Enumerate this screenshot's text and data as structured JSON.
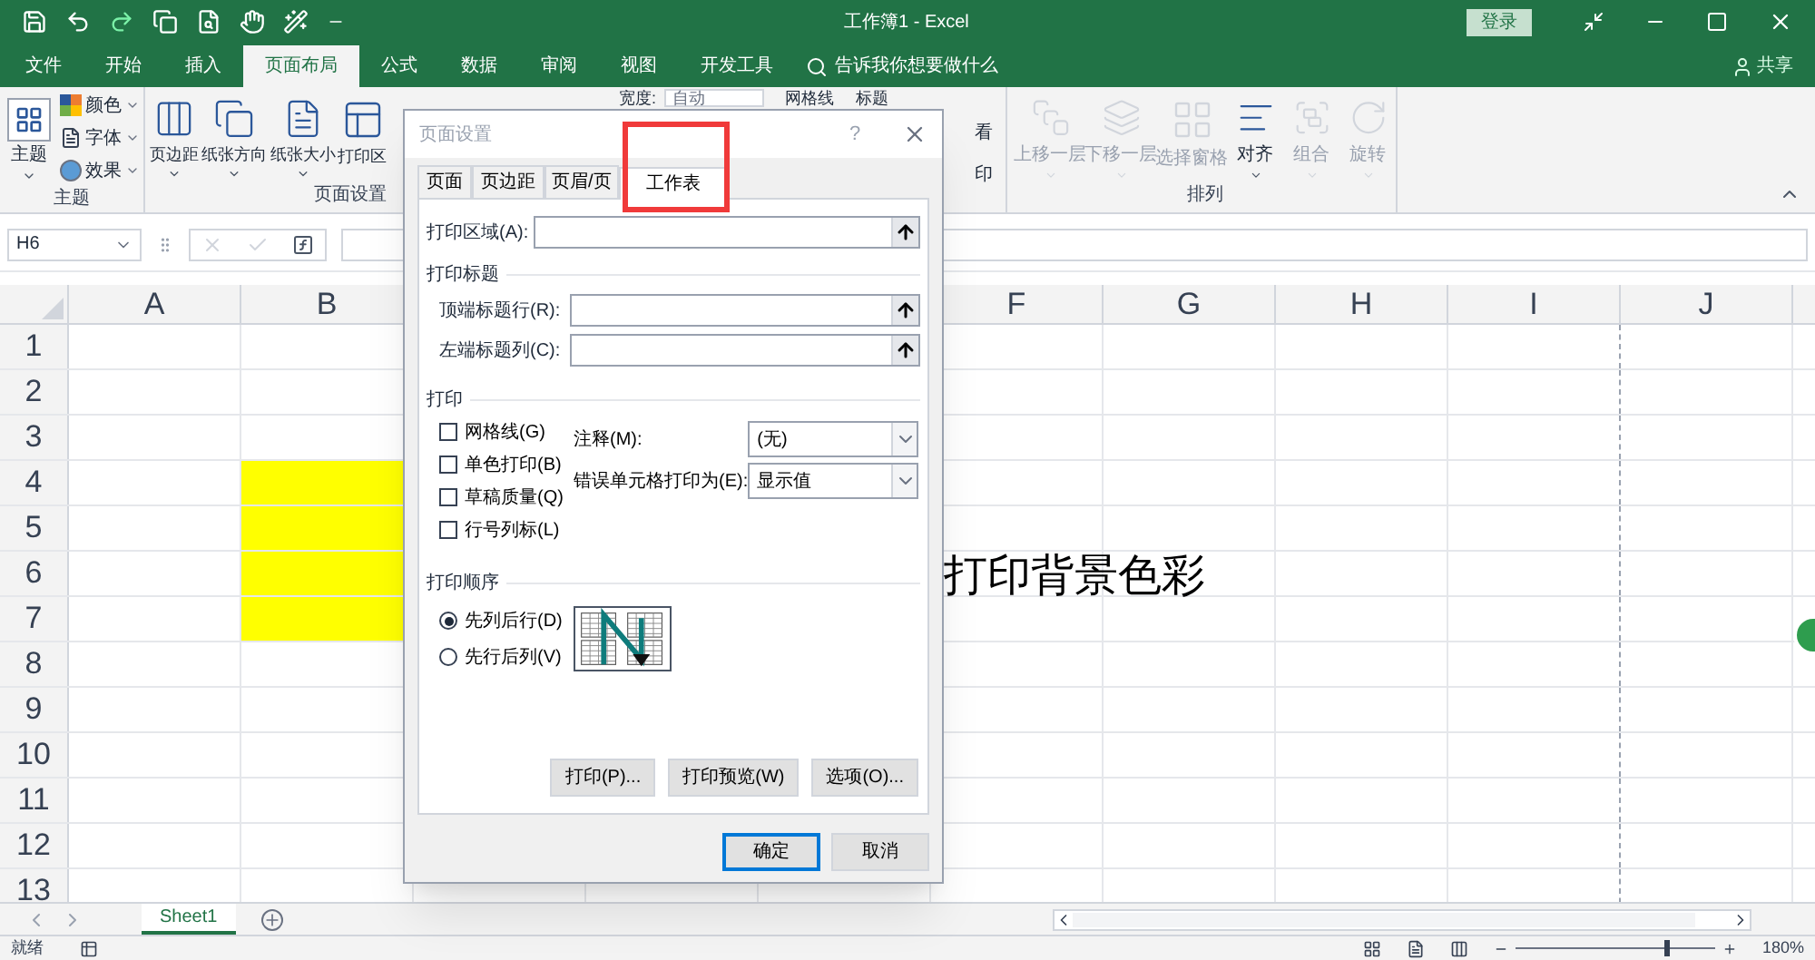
{
  "window": {
    "title": "工作簿1 - Excel",
    "sign_in": "登录"
  },
  "ribbon_tabs": [
    {
      "label": "文件",
      "selected": false
    },
    {
      "label": "开始",
      "selected": false
    },
    {
      "label": "插入",
      "selected": false
    },
    {
      "label": "页面布局",
      "selected": true
    },
    {
      "label": "公式",
      "selected": false
    },
    {
      "label": "数据",
      "selected": false
    },
    {
      "label": "审阅",
      "selected": false
    },
    {
      "label": "视图",
      "selected": false
    },
    {
      "label": "开发工具",
      "selected": false
    }
  ],
  "tell_me": "告诉我你想要做什么",
  "share": "共享",
  "theme_group": {
    "label": "主题",
    "big": "主题",
    "small": [
      "颜色",
      "字体",
      "效果"
    ]
  },
  "page_setup_group": {
    "label": "页面设置",
    "buttons": [
      "页边距",
      "纸张方向",
      "纸张大小",
      "打印区"
    ]
  },
  "scale_peek": {
    "width_label": "宽度:",
    "width_value": "自动"
  },
  "sheet_options_peek": {
    "gridlines": "网格线",
    "headings": "标题",
    "view": "看",
    "print": "印"
  },
  "arrange_group": {
    "label": "排列",
    "buttons": [
      {
        "label": "上移一层",
        "disabled": true
      },
      {
        "label": "下移一层",
        "disabled": true
      },
      {
        "label": "选择窗格",
        "disabled": true
      },
      {
        "label": "对齐",
        "disabled": false
      },
      {
        "label": "组合",
        "disabled": true
      },
      {
        "label": "旋转",
        "disabled": true
      }
    ]
  },
  "name_box": "H6",
  "columns": [
    "A",
    "B",
    "F",
    "G",
    "H",
    "I",
    "J"
  ],
  "rows": [
    {
      "label": "1",
      "filled": false
    },
    {
      "label": "2",
      "filled": false
    },
    {
      "label": "3",
      "filled": false
    },
    {
      "label": "4",
      "filled": true
    },
    {
      "label": "5",
      "filled": true
    },
    {
      "label": "6",
      "filled": true
    },
    {
      "label": "7",
      "filled": true
    },
    {
      "label": "8",
      "filled": false
    },
    {
      "label": "9",
      "filled": false
    },
    {
      "label": "10",
      "filled": false
    },
    {
      "label": "11",
      "filled": false
    },
    {
      "label": "12",
      "filled": false
    },
    {
      "label": "13",
      "filled": false
    }
  ],
  "cell_text": "打印背景色彩",
  "sheet_tabs": [
    {
      "label": "Sheet1",
      "selected": true
    }
  ],
  "status_bar": {
    "text": "就绪",
    "zoom": "180%",
    "zoom_slider": {
      "level": 0.75
    }
  },
  "dialog": {
    "title": "页面设置",
    "help": "?",
    "tabs": [
      {
        "label": "页面",
        "selected": false
      },
      {
        "label": "页边距",
        "selected": false
      },
      {
        "label": "页眉/页",
        "selected": false
      },
      {
        "label": "工作表",
        "selected": true
      }
    ],
    "print_area": {
      "label": "打印区域(A):"
    },
    "titles_section": "打印标题",
    "title_fields": [
      {
        "label": "顶端标题行(R):"
      },
      {
        "label": "左端标题列(C):"
      }
    ],
    "print_section": "打印",
    "checkboxes": [
      {
        "label": "网格线(G)",
        "checked": false
      },
      {
        "label": "单色打印(B)",
        "checked": false
      },
      {
        "label": "草稿质量(Q)",
        "checked": false
      },
      {
        "label": "行号列标(L)",
        "checked": false
      }
    ],
    "selects": [
      {
        "label": "注释(M):",
        "value": "(无)"
      },
      {
        "label": "错误单元格打印为(E):",
        "value": "显示值"
      }
    ],
    "order_section": "打印顺序",
    "order_options": [
      {
        "label": "先列后行(D)",
        "selected": true
      },
      {
        "label": "先行后列(V)",
        "selected": false
      }
    ],
    "panel_buttons": [
      "打印(P)...",
      "打印预览(W)",
      "选项(O)..."
    ],
    "ok": "确定",
    "cancel": "取消"
  }
}
